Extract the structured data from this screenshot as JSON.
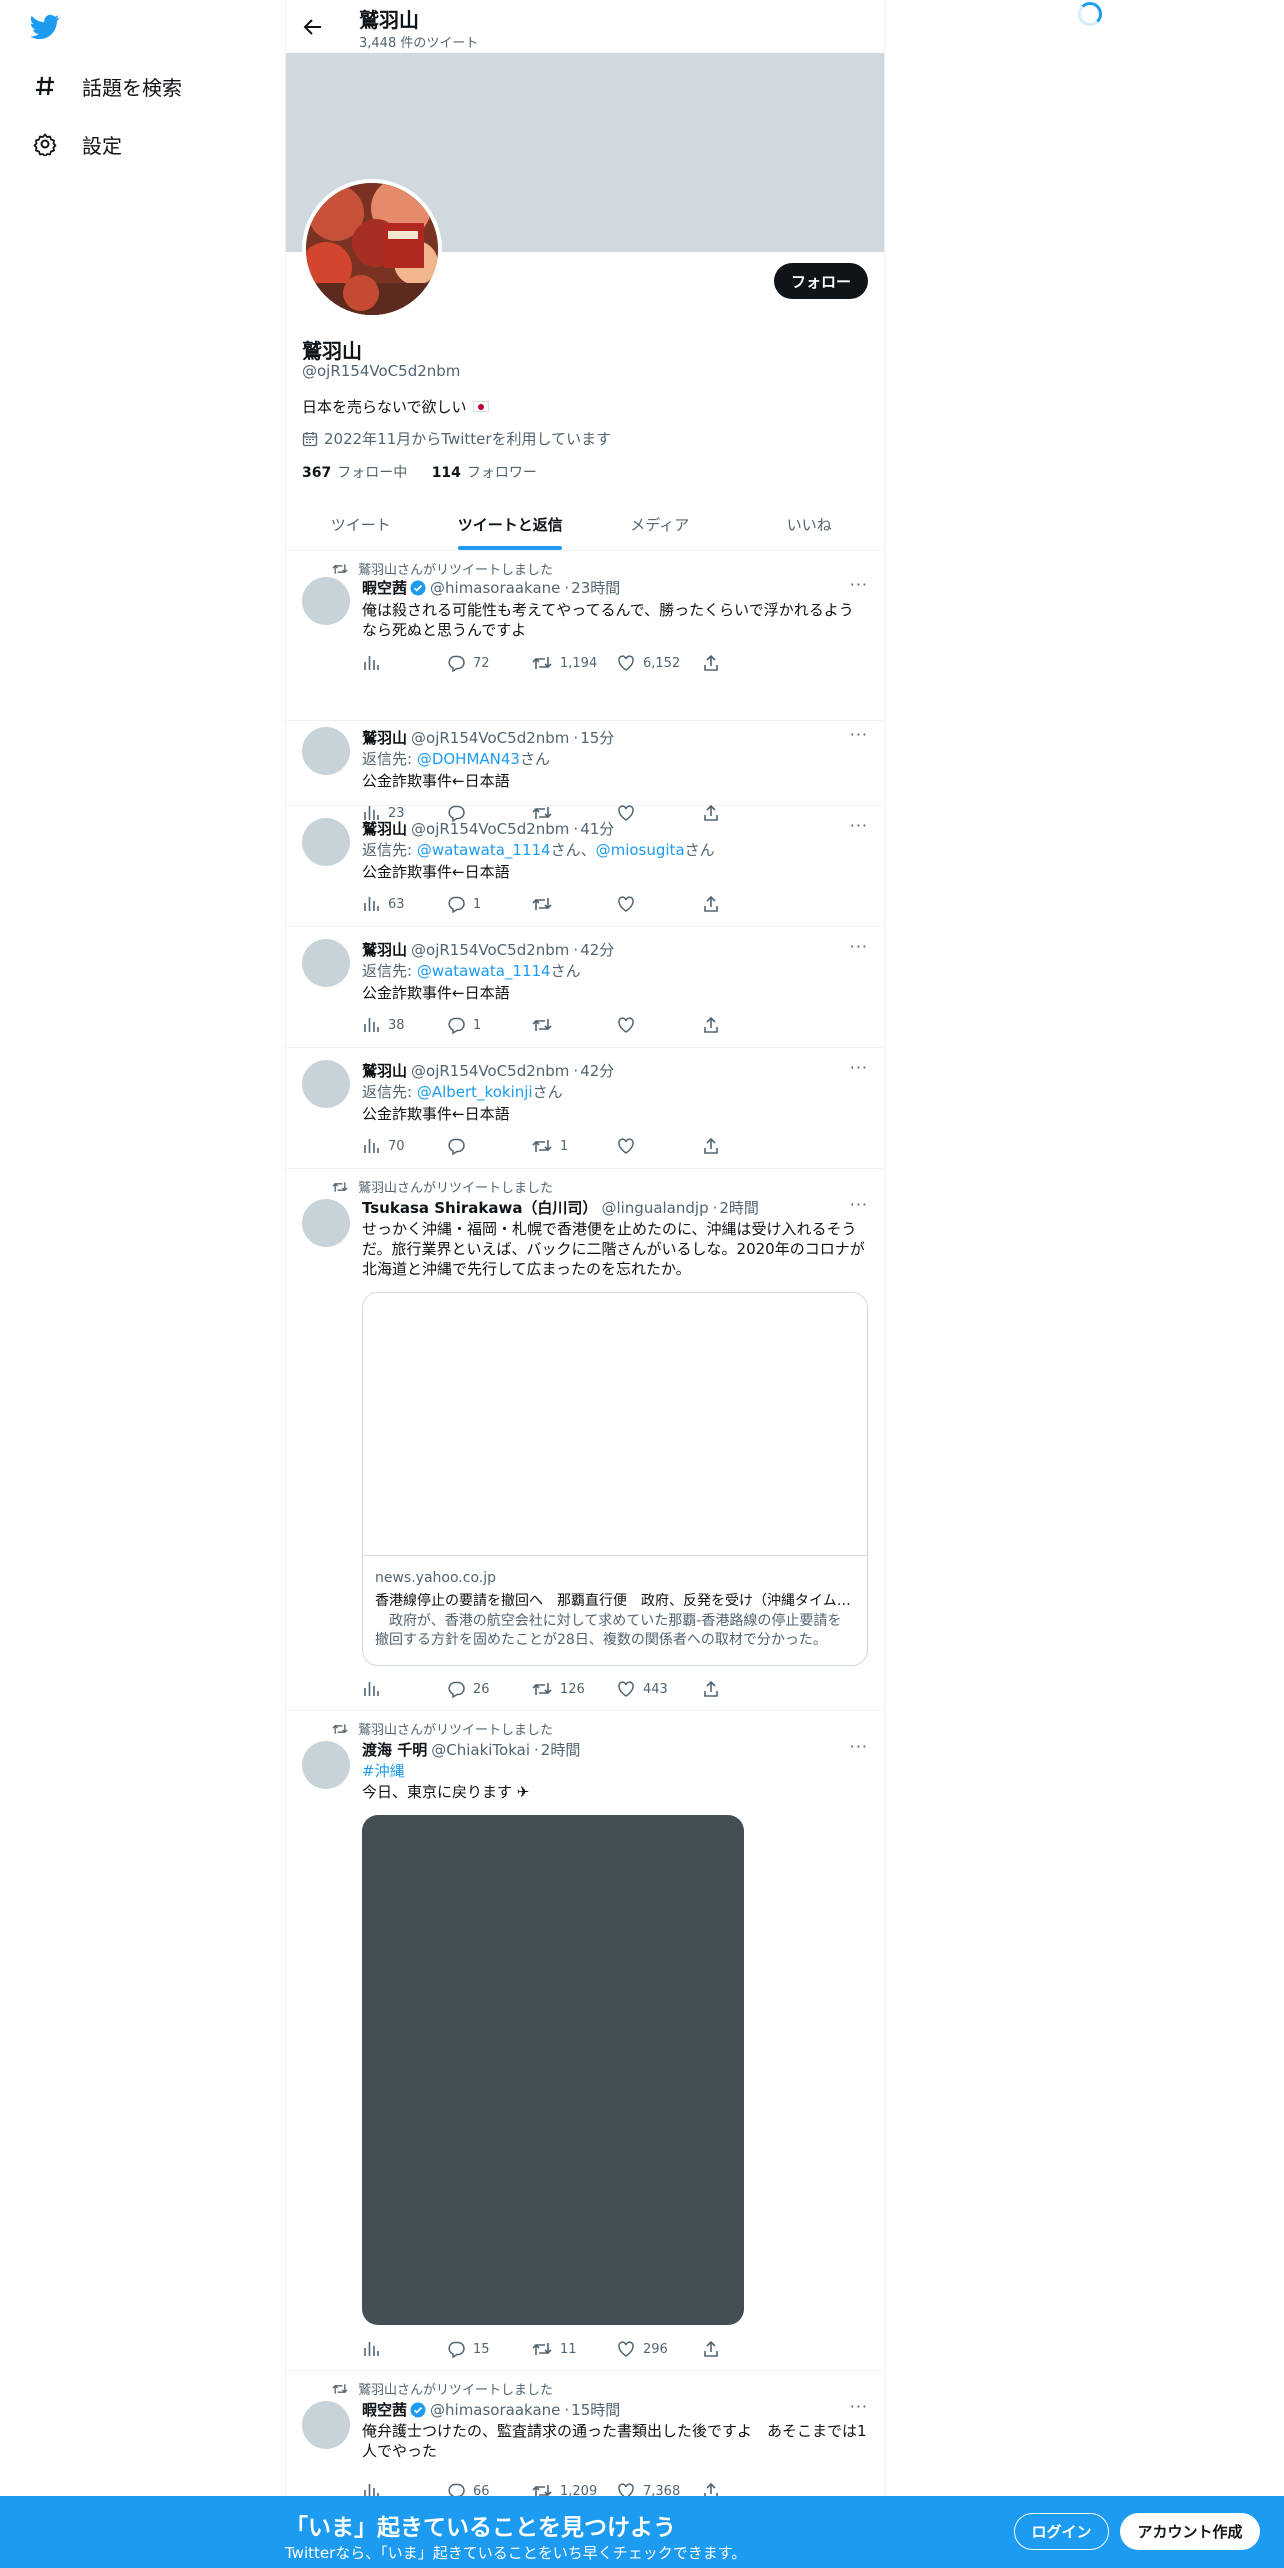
{
  "nav": {
    "logo_icon": "twitter-bird-icon",
    "items": [
      {
        "icon": "hashtag-icon",
        "label": "話題を検索"
      },
      {
        "icon": "gear-icon",
        "label": "設定"
      }
    ]
  },
  "header": {
    "title": "鷲羽山",
    "tweet_count": "3,448 件のツイート"
  },
  "profile": {
    "follow_label": "フォロー",
    "name": "鷲羽山",
    "handle": "@ojR154VoC5d2nbm",
    "bio": "日本を売らないで欲しい",
    "joined": "2022年11月からTwitterを利用しています",
    "following_count": "367",
    "following_label": "フォロー中",
    "followers_count": "114",
    "followers_label": "フォロワー"
  },
  "tabs": [
    {
      "label": "ツイート"
    },
    {
      "label": "ツイートと返信"
    },
    {
      "label": "メディア"
    },
    {
      "label": "いいね"
    }
  ],
  "tweets": [
    {
      "retweet_note": "鷲羽山さんがリツイートしました",
      "name": "暇空茜",
      "handle": "@himasoraakane",
      "time": "23時間",
      "text": "俺は殺される可能性も考えてやってるんで、勝ったくらいで浮かれるようなら死ぬと思うんですよ",
      "views": "",
      "replies": "72",
      "retweets": "1,194",
      "likes": "6,152"
    },
    {
      "name": "鷲羽山",
      "handle": "@ojR154VoC5d2nbm",
      "time": "15分",
      "reply_prefix": "返信先: ",
      "reply_to": "@DOHMAN43",
      "reply_suffix": "さん",
      "text": "公金詐欺事件←日本語",
      "views": "23",
      "replies": "",
      "retweets": "",
      "likes": ""
    },
    {
      "name": "鷲羽山",
      "handle": "@ojR154VoC5d2nbm",
      "time": "41分",
      "reply_prefix": "返信先: ",
      "reply_to": "@watawata_1114",
      "reply_mid": "さん、",
      "reply_to2": "@miosugita",
      "reply_suffix": "さん",
      "text": "公金詐欺事件←日本語",
      "views": "63",
      "replies": "1",
      "retweets": "",
      "likes": ""
    },
    {
      "name": "鷲羽山",
      "handle": "@ojR154VoC5d2nbm",
      "time": "42分",
      "reply_prefix": "返信先: ",
      "reply_to": "@watawata_1114",
      "reply_suffix": "さん",
      "text": "公金詐欺事件←日本語",
      "views": "38",
      "replies": "1",
      "retweets": "",
      "likes": ""
    },
    {
      "name": "鷲羽山",
      "handle": "@ojR154VoC5d2nbm",
      "time": "42分",
      "reply_prefix": "返信先: ",
      "reply_to": "@Albert_kokinji",
      "reply_suffix": "さん",
      "text": "公金詐欺事件←日本語",
      "views": "70",
      "replies": "",
      "retweets": "1",
      "likes": ""
    },
    {
      "retweet_note": "鷲羽山さんがリツイートしました",
      "name": "Tsukasa Shirakawa（白川司）",
      "handle": "@lingualandjp",
      "time": "2時間",
      "text": "せっかく沖縄・福岡・札幌で香港便を止めたのに、沖縄は受け入れるそうだ。旅行業界といえば、バックに二階さんがいるしな。2020年のコロナが北海道と沖縄で先行して広まったのを忘れたか。",
      "card_domain": "news.yahoo.co.jp",
      "card_title": "香港線停止の要請を撤回へ　那覇直行便　政府、反発を受け（沖縄タイムス）",
      "card_desc": "　政府が、香港の航空会社に対して求めていた那覇-香港路線の停止要請を撤回する方針を固めたことが28日、複数の関係者への取材で分かった。",
      "views": "",
      "replies": "26",
      "retweets": "126",
      "likes": "443"
    },
    {
      "retweet_note": "鷲羽山さんがリツイートしました",
      "name": "渡海 千明",
      "handle": "@ChiakiTokai",
      "time": "2時間",
      "hashtag": "#沖縄",
      "text": "今日、東京に戻ります ✈",
      "views": "",
      "replies": "15",
      "retweets": "11",
      "likes": "296"
    },
    {
      "retweet_note": "鷲羽山さんがリツイートしました",
      "name": "暇空茜",
      "handle": "@himasoraakane",
      "time": "15時間",
      "text": "俺弁護士つけたの、監査請求の通った書類出した後ですよ　あそこまでは1人でやった",
      "views": "",
      "replies": "66",
      "retweets": "1,209",
      "likes": "7,368"
    }
  ],
  "bottom_bar": {
    "headline": "「いま」起きていることを見つけよう",
    "subline": "Twitterなら、「いま」起きていることをいち早くチェックできます。",
    "login_label": "ログイン",
    "signup_label": "アカウント作成"
  },
  "colors": {
    "accent": "#1d9bf0",
    "banner": "#cfd9de",
    "text": "#0f1419",
    "muted": "#536471"
  }
}
